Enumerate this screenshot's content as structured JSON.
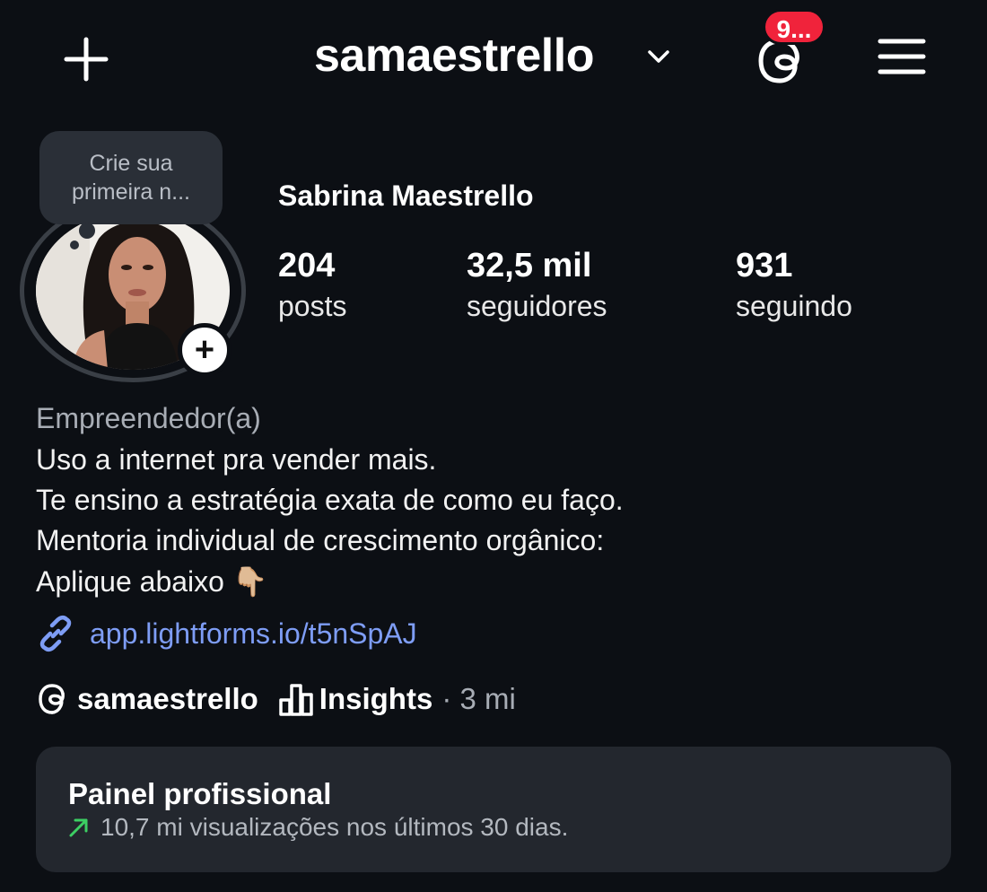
{
  "header": {
    "username": "samaestrello",
    "notification_badge": "9...",
    "icons": {
      "new_post": "plus-icon",
      "account_switch": "chevron-down-icon",
      "threads": "threads-icon",
      "menu": "hamburger-menu-icon"
    }
  },
  "profile": {
    "note_bubble": "Crie sua primeira n...",
    "full_name": "Sabrina Maestrello",
    "stats": [
      {
        "value": "204",
        "label": "posts"
      },
      {
        "value": "32,5 mil",
        "label": "seguidores"
      },
      {
        "value": "931",
        "label": "seguindo"
      }
    ],
    "category": "Empreendedor(a)",
    "bio_lines": [
      "Uso a internet pra vender mais.",
      "Te ensino a estratégia exata de como eu faço.",
      "Mentoria individual de crescimento orgânico:",
      "Aplique abaixo 👇🏼"
    ],
    "link": "app.lightforms.io/t5nSpAJ"
  },
  "meta": {
    "threads_handle": "samaestrello",
    "insights_label": "Insights",
    "insights_time": "· 3 mi"
  },
  "panel": {
    "title": "Painel profissional",
    "subtitle": "10,7 mi visualizações nos últimos 30 dias."
  },
  "colors": {
    "background": "#0c0f14",
    "badge": "#f0233b",
    "link": "#7e9df5",
    "panel": "#23272e",
    "trend_up": "#3ccf63"
  }
}
